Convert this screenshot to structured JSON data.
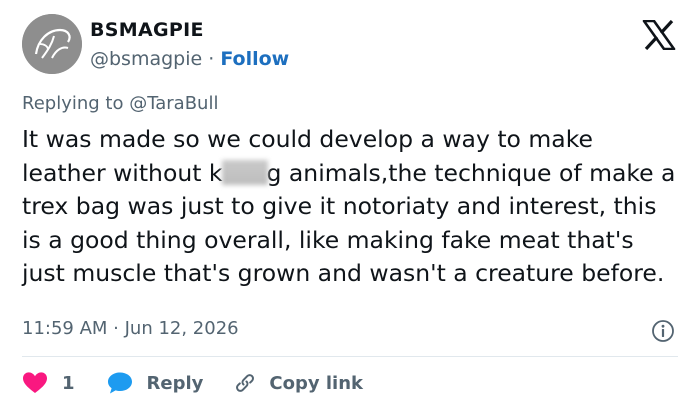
{
  "author": {
    "display_name": "BSMAGPIE",
    "handle": "@bsmagpie",
    "separator": "·",
    "follow_label": "Follow"
  },
  "reply_to": {
    "prefix": "Replying to",
    "mention": "@TaraBull"
  },
  "tweet": {
    "text_before_blur": "It was made so we could develop a way to make leather without k",
    "text_after_blur": "g animals,the technique of make a trex bag was just to give it notoriaty and interest, this is a good thing overall, like making fake meat that's just muscle that's grown and wasn't a creature before.",
    "timestamp": "11:59 AM · Jun 12, 2026"
  },
  "actions": {
    "like_count": "1",
    "reply_label": "Reply",
    "copy_link_label": "Copy link"
  },
  "colors": {
    "like": "#f91880",
    "reply": "#1d9bf0",
    "link": "#1d6fbf",
    "secondary_text": "#536471",
    "primary_text": "#0f1419",
    "avatar": "#8e8e8e"
  },
  "icons": {
    "brand": "x-logo-icon",
    "like": "heart-icon",
    "reply": "speech-bubble-icon",
    "copy": "link-icon",
    "info": "info-icon"
  }
}
